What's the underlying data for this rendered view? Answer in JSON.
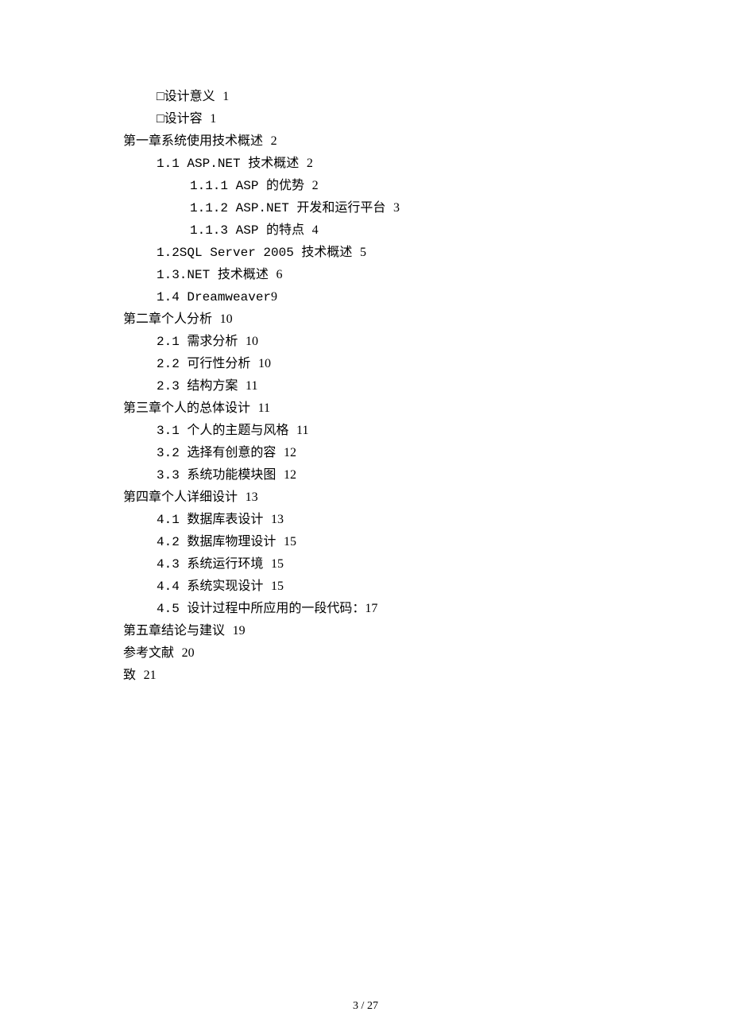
{
  "toc": {
    "entries": [
      {
        "indent": 1,
        "prefix": "□",
        "text": "设计意义",
        "page": "1"
      },
      {
        "indent": 1,
        "prefix": "□",
        "text": "设计容",
        "page": "1"
      },
      {
        "indent": 0,
        "prefix": "",
        "text": "第一章系统使用技术概述",
        "page": "2"
      },
      {
        "indent": 1,
        "prefix": "",
        "text": "1.1 ASP.NET 技术概述",
        "page": "2"
      },
      {
        "indent": 2,
        "prefix": "",
        "text": "1.1.1 ASP 的优势",
        "page": "2"
      },
      {
        "indent": 2,
        "prefix": "",
        "text": "1.1.2 ASP.NET 开发和运行平台",
        "page": "3"
      },
      {
        "indent": 2,
        "prefix": "",
        "text": "1.1.3 ASP 的特点",
        "page": "4"
      },
      {
        "indent": 1,
        "prefix": "",
        "text": "1.2SQL Server 2005 技术概述",
        "page": "5"
      },
      {
        "indent": 1,
        "prefix": "",
        "text": "1.3.NET 技术概述",
        "page": "6"
      },
      {
        "indent": 1,
        "prefix": "",
        "text": "1.4 Dreamweaver",
        "page": "9"
      },
      {
        "indent": 0,
        "prefix": "",
        "text": "第二章个人分析",
        "page": "10"
      },
      {
        "indent": 1,
        "prefix": "",
        "text": "2.1 需求分析",
        "page": "10"
      },
      {
        "indent": 1,
        "prefix": "",
        "text": "2.2 可行性分析",
        "page": "10"
      },
      {
        "indent": 1,
        "prefix": "",
        "text": "2.3 结构方案",
        "page": "11"
      },
      {
        "indent": 0,
        "prefix": "",
        "text": "第三章个人的总体设计",
        "page": "11"
      },
      {
        "indent": 1,
        "prefix": "",
        "text": "3.1 个人的主题与风格",
        "page": "11"
      },
      {
        "indent": 1,
        "prefix": "",
        "text": "3.2 选择有创意的容",
        "page": "12"
      },
      {
        "indent": 1,
        "prefix": "",
        "text": "3.3 系统功能模块图",
        "page": "12"
      },
      {
        "indent": 0,
        "prefix": "",
        "text": "第四章个人详细设计",
        "page": "13"
      },
      {
        "indent": 1,
        "prefix": "",
        "text": "4.1 数据库表设计",
        "page": "13"
      },
      {
        "indent": 1,
        "prefix": "",
        "text": "4.2 数据库物理设计",
        "page": "15"
      },
      {
        "indent": 1,
        "prefix": "",
        "text": "4.3 系统运行环境",
        "page": "15"
      },
      {
        "indent": 1,
        "prefix": "",
        "text": "4.4 系统实现设计",
        "page": "15"
      },
      {
        "indent": 1,
        "prefix": "",
        "text": "4.5 设计过程中所应用的一段代码：",
        "page": "17"
      },
      {
        "indent": 0,
        "prefix": "",
        "text": "第五章结论与建议",
        "page": "19"
      },
      {
        "indent": 0,
        "prefix": "",
        "text": "参考文献",
        "page": "20"
      },
      {
        "indent": 0,
        "prefix": "",
        "text": "致",
        "page": "21"
      }
    ]
  },
  "footer": {
    "current_page": "3",
    "separator": " / ",
    "total_pages": "27"
  }
}
